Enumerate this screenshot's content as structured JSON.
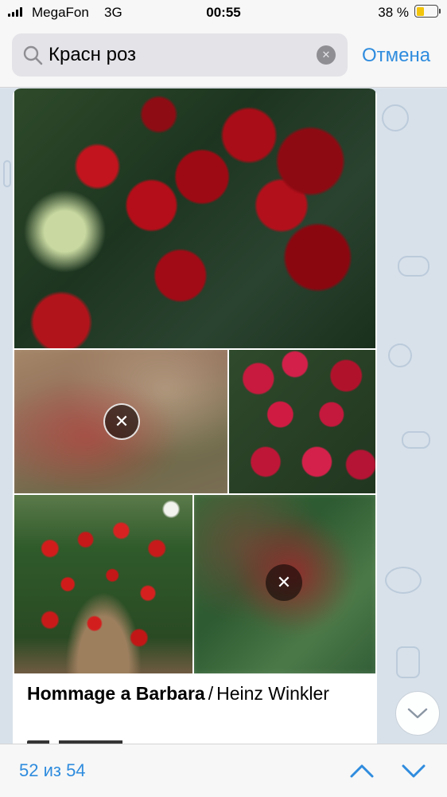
{
  "status_bar": {
    "carrier": "MegaFon",
    "network": "3G",
    "time": "00:55",
    "battery_percent": "38 %"
  },
  "search": {
    "query": "Красн роз",
    "cancel_label": "Отмена"
  },
  "message": {
    "caption_title": "Hommage a Barbara",
    "caption_separator": "/",
    "caption_author": "Heinz Winkler",
    "photos": [
      {
        "name": "red-roses-bush-closeup",
        "state": "loaded"
      },
      {
        "name": "blurred-photo",
        "state": "loading"
      },
      {
        "name": "red-roses-cluster",
        "state": "loaded"
      },
      {
        "name": "rose-shrub-garden",
        "state": "loaded"
      },
      {
        "name": "blurred-photo",
        "state": "loading"
      }
    ]
  },
  "search_results": {
    "counter": "52 из 54"
  },
  "colors": {
    "accent": "#2f8cde",
    "chat_background": "#d8e1ea"
  },
  "icons": [
    "search-icon",
    "clear-icon",
    "close-icon",
    "chevron-down-icon",
    "chevron-up-icon"
  ]
}
